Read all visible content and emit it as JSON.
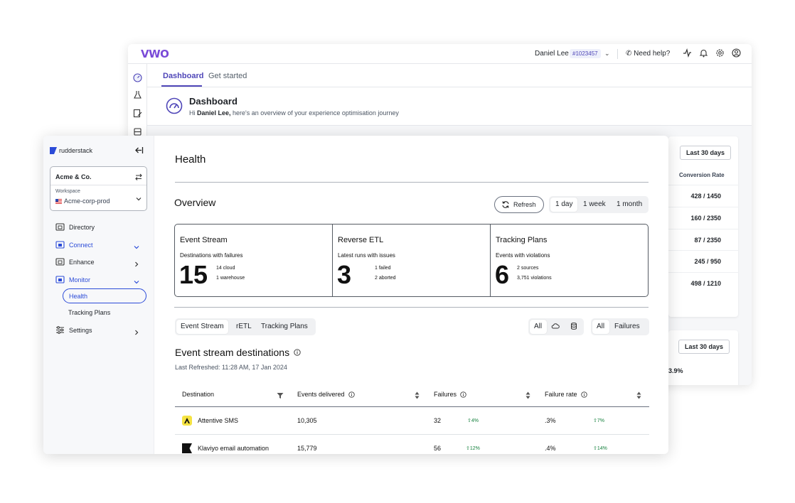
{
  "vwo": {
    "user_name": "Daniel Lee",
    "account_id": "#1023457",
    "help_label": "Need help?",
    "tabs": [
      {
        "label": "Dashboard",
        "active": true
      },
      {
        "label": "Get started",
        "active": false
      }
    ],
    "heading": "Dashboard",
    "subtitle_prefix": "Hi ",
    "subtitle_name": "Daniel Lee,",
    "subtitle_rest": " here's an overview of your experience optimisation journey",
    "range_fragment_1": "s",
    "range_fragment_2": "s",
    "range_btn_1": "Last 30 days",
    "range_btn_2": "Last 30 days",
    "column_header": "Conversion Rate",
    "rows": [
      "428 / 1450",
      "160 / 2350",
      "87 / 2350",
      "245 / 950",
      "498 / 1210"
    ],
    "percent": "3.9%",
    "colors": {
      "brand": "#7a4bd8",
      "accent": "#4f46b8"
    }
  },
  "rs": {
    "brand": "rudderstack",
    "org_name": "Acme & Co.",
    "workspace_label": "Workspace",
    "workspace_value": "Acme-corp-prod",
    "nav": {
      "directory": "Directory",
      "connect": "Connect",
      "enhance": "Enhance",
      "monitor": "Monitor",
      "health": "Health",
      "tracking_plans": "Tracking Plans",
      "settings": "Settings"
    },
    "page_title": "Health",
    "overview_title": "Overview",
    "refresh_label": "Refresh",
    "ranges": [
      "1 day",
      "1 week",
      "1 month"
    ],
    "stats": [
      {
        "title": "Event Stream",
        "subtitle": "Destinations with failures",
        "number": "15",
        "detail_1": "14 cloud",
        "detail_2": "1 warehouse"
      },
      {
        "title": "Reverse ETL",
        "subtitle": "Latest runs with issues",
        "number": "3",
        "detail_1": "1 failed",
        "detail_2": "2 aborted"
      },
      {
        "title": "Tracking Plans",
        "subtitle": "Events with violations",
        "number": "6",
        "detail_1": "2 sources",
        "detail_2": "3,751 violations"
      }
    ],
    "tabs": [
      "Event Stream",
      "rETL",
      "Tracking Plans"
    ],
    "filter_type_all": "All",
    "filter_status_all": "All",
    "filter_status_failures": "Failures",
    "section_title": "Event stream destinations",
    "last_refreshed": "Last Refreshed: 11:28 AM, 17 Jan 2024",
    "table": {
      "headers": {
        "destination": "Destination",
        "events": "Events delivered",
        "failures": "Failures",
        "rate": "Failure rate"
      },
      "rows": [
        {
          "destination": "Attentive SMS",
          "events": "10,305",
          "failures": "32",
          "failures_trend": "4%",
          "rate": ".3%",
          "rate_trend": "7%"
        },
        {
          "destination": "Klaviyo email automation",
          "events": "15,779",
          "failures": "56",
          "failures_trend": "12%",
          "rate": ".4%",
          "rate_trend": "14%"
        }
      ]
    },
    "colors": {
      "accent": "#2b4bd8",
      "positive": "#15803d"
    }
  }
}
